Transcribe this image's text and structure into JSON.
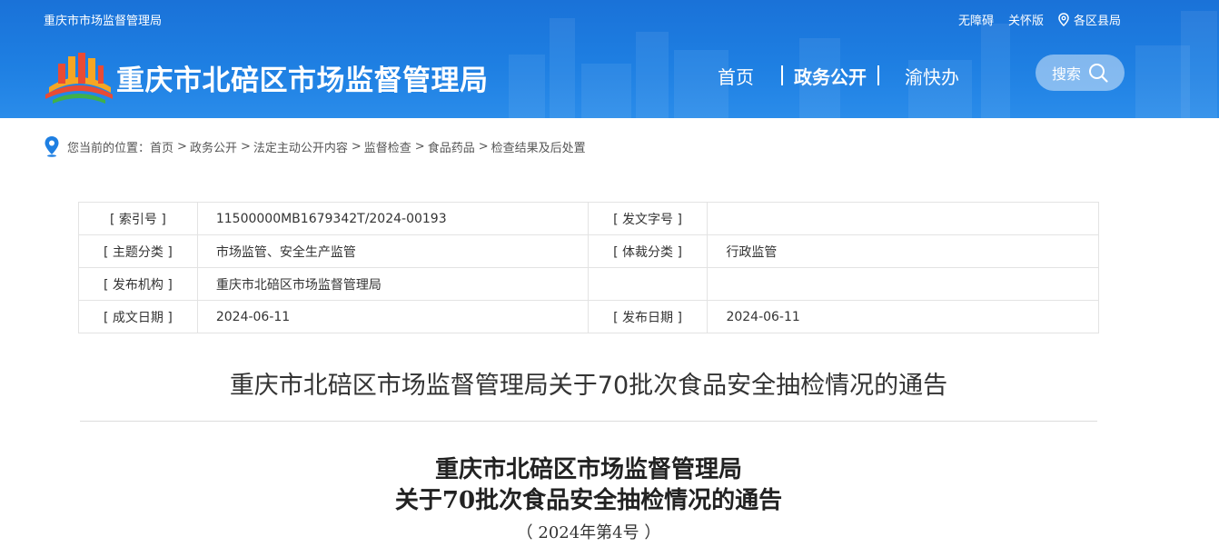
{
  "header": {
    "site_name_small": "重庆市市场监督管理局",
    "links": {
      "accessibility": "无障碍",
      "elderly": "关怀版",
      "districts": "各区县局"
    },
    "site_title": "重庆市北碚区市场监督管理局",
    "nav": {
      "home": "首页",
      "gov_affairs": "政务公开",
      "yukuaiban": "渝快办"
    },
    "search_label": "搜索",
    "colors": {
      "banner": "#1e7fe2",
      "text": "#ffffff"
    }
  },
  "breadcrumb": {
    "prefix": "您当前的位置：",
    "items": [
      "首页",
      "政务公开",
      "法定主动公开内容",
      "监督检查",
      "食品药品",
      "检查结果及后处置"
    ]
  },
  "meta": {
    "rows": [
      {
        "l1": "[ 索引号 ]",
        "v1": "11500000MB1679342T/2024-00193",
        "l2": "[ 发文字号 ]",
        "v2": ""
      },
      {
        "l1": "[ 主题分类 ]",
        "v1": "市场监管、安全生产监管",
        "l2": "[ 体裁分类 ]",
        "v2": "行政监管"
      },
      {
        "l1": "[ 发布机构 ]",
        "v1": "重庆市北碚区市场监督管理局",
        "l2": "",
        "v2": ""
      },
      {
        "l1": "[ 成文日期 ]",
        "v1": "2024-06-11",
        "l2": "[ 发布日期 ]",
        "v2": "2024-06-11"
      }
    ]
  },
  "article": {
    "title": "重庆市北碚区市场监督管理局关于70批次食品安全抽检情况的通告",
    "body_head_line1": "重庆市北碚区市场监督管理局",
    "body_head_line2": "关于70批次食品安全抽检情况的通告",
    "body_head_number": "（ 2024年第4号 ）"
  }
}
